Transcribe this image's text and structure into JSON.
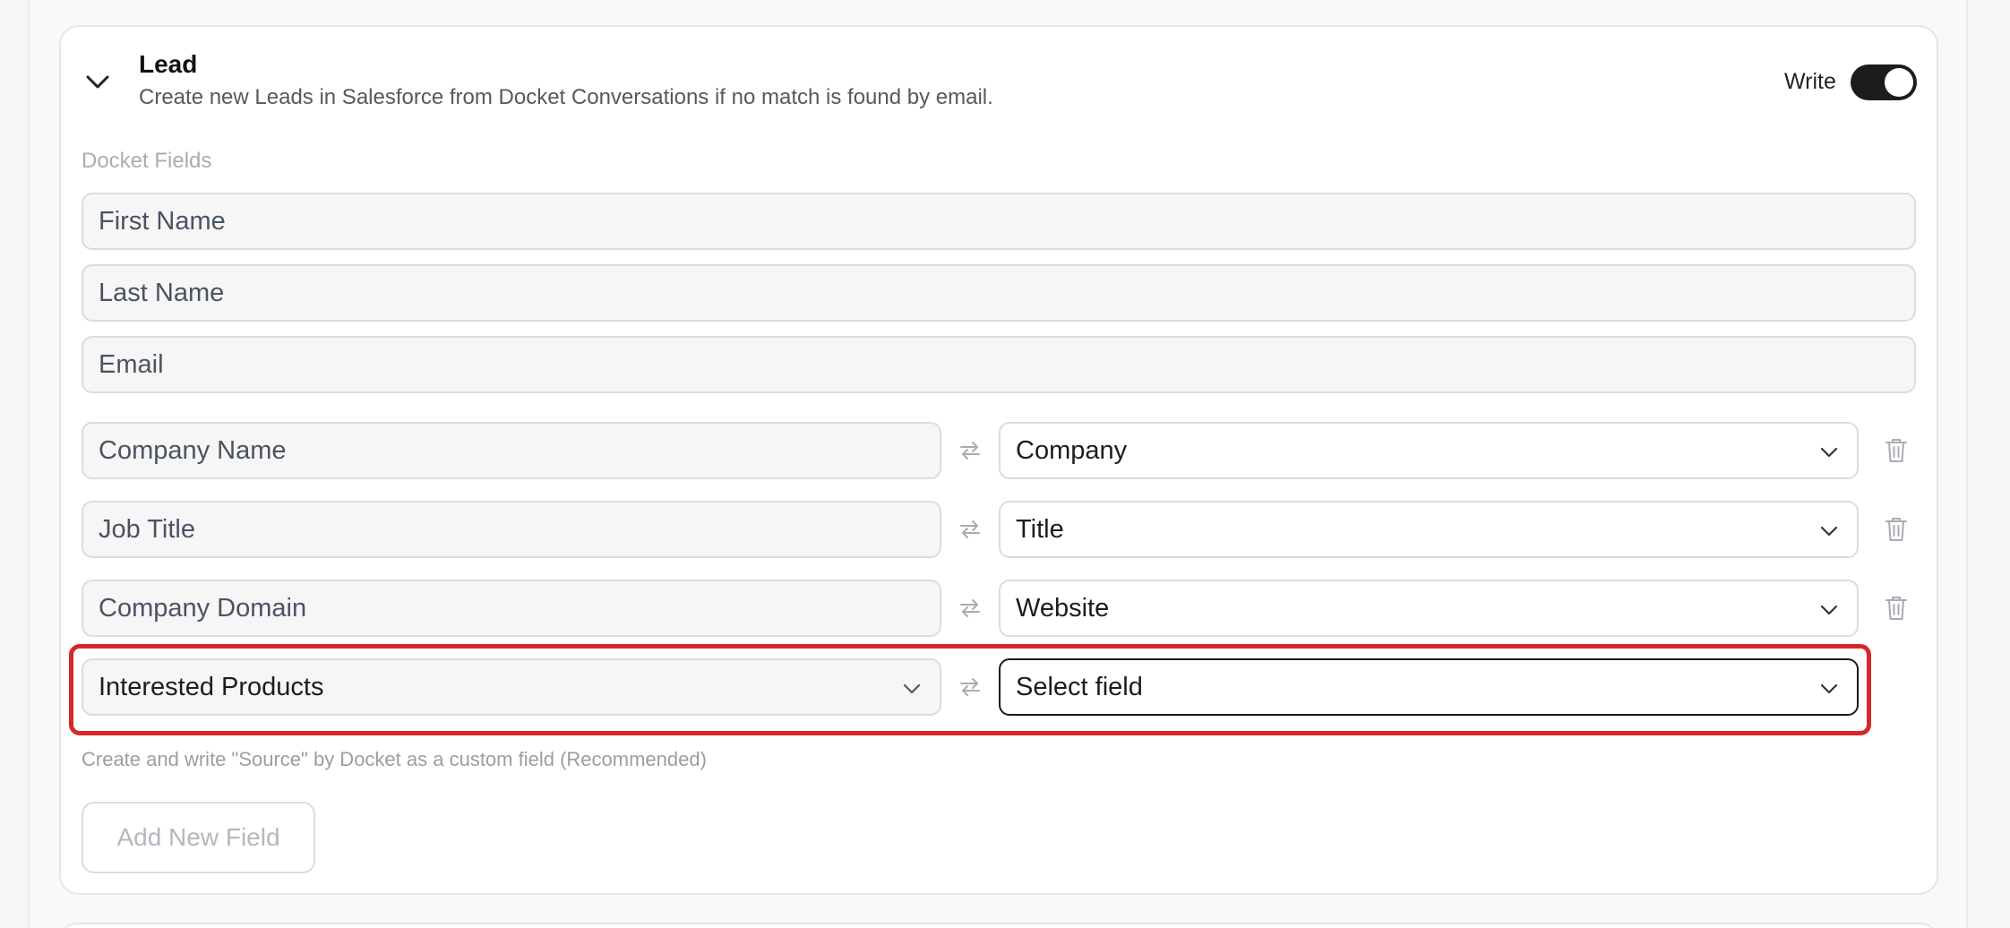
{
  "section": {
    "title": "Lead",
    "description": "Create new Leads in Salesforce from Docket Conversations if no match is found by email.",
    "write_label": "Write",
    "write_enabled": true,
    "fields_label": "Docket Fields"
  },
  "fixed_fields": [
    {
      "value": "First Name"
    },
    {
      "value": "Last Name"
    },
    {
      "value": "Email"
    }
  ],
  "mappings": [
    {
      "docket_field": "Company Name",
      "salesforce_field": "Company"
    },
    {
      "docket_field": "Job Title",
      "salesforce_field": "Title"
    },
    {
      "docket_field": "Company Domain",
      "salesforce_field": "Website"
    }
  ],
  "new_mapping": {
    "docket_field": "Interested Products",
    "salesforce_placeholder": "Select field"
  },
  "hint": "Create and write \"Source\" by Docket as a custom field (Recommended)",
  "add_button": "Add New Field",
  "colors": {
    "highlight": "#d62828",
    "toggle_on": "#1c1c1e"
  },
  "icons": {
    "collapse": "chevron-down-icon",
    "swap": "swap-arrows-icon",
    "delete": "trash-icon",
    "dropdown": "chevron-down-icon"
  }
}
